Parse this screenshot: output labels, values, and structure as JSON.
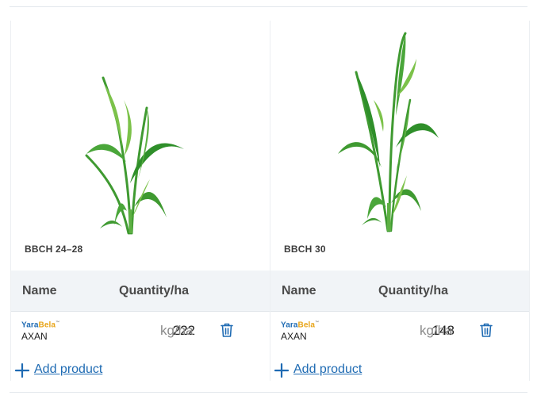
{
  "cards": [
    {
      "stage": "BBCH 24–28",
      "table": {
        "name_header": "Name",
        "quantity_header": "Quantity/ha"
      },
      "product": {
        "brand_yara": "Yara",
        "brand_bela": "Bela",
        "brand_tm": "™",
        "name": "AXAN",
        "quantity": "222",
        "unit": "kg/ha"
      },
      "add_label": "Add product"
    },
    {
      "stage": "BBCH 30",
      "table": {
        "name_header": "Name",
        "quantity_header": "Quantity/ha"
      },
      "product": {
        "brand_yara": "Yara",
        "brand_bela": "Bela",
        "brand_tm": "™",
        "name": "AXAN",
        "quantity": "148",
        "unit": "kg/ha"
      },
      "add_label": "Add product"
    }
  ],
  "colors": {
    "accent": "#1f6bb3",
    "brand_yellow": "#e8a51b",
    "header_bg": "#f1f4f7",
    "leaf_dark": "#2f8f2a",
    "leaf_light": "#7cc24a"
  },
  "icons": {
    "delete": "trash-icon",
    "add": "plus-icon"
  }
}
